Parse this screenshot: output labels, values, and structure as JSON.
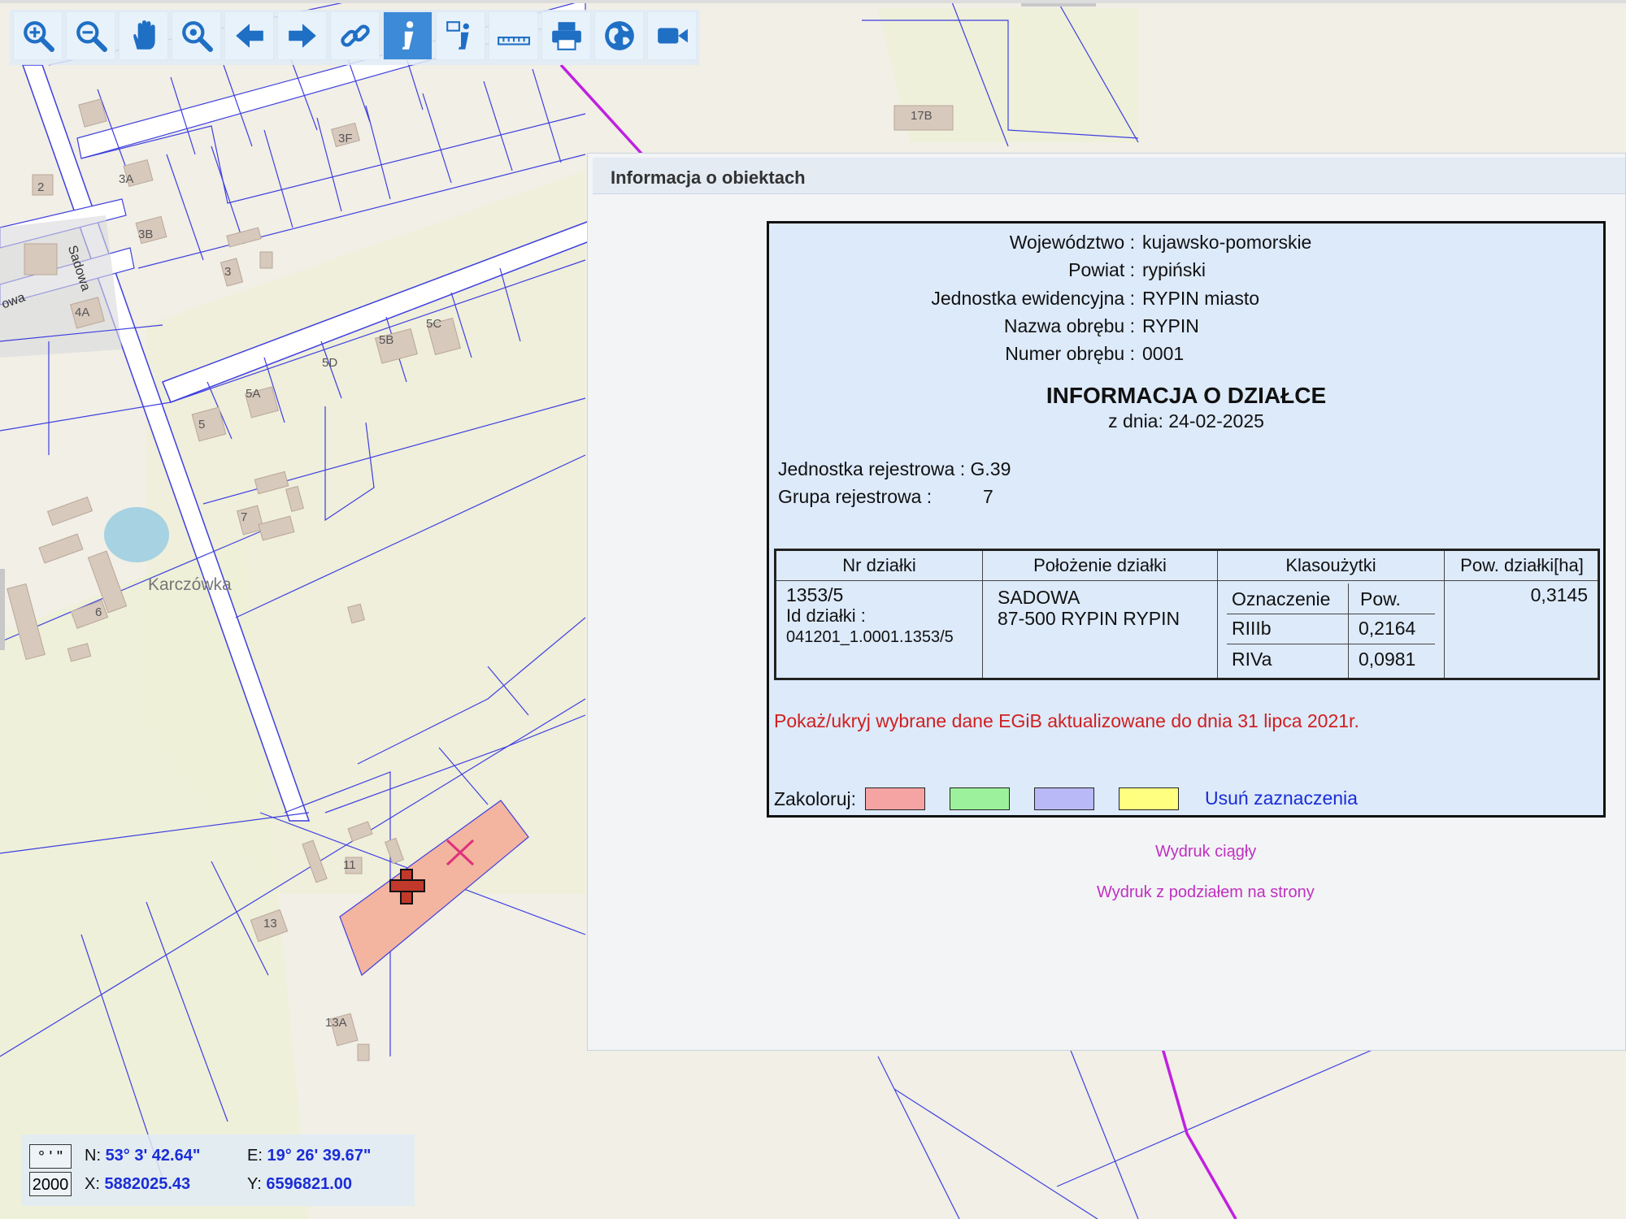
{
  "map": {
    "street_label": "Sadowa",
    "street_label_cut": "owa",
    "locality": "Karczówka",
    "house_numbers": [
      "2",
      "3A",
      "3B",
      "3F",
      "3",
      "4A",
      "5",
      "5A",
      "5B",
      "5C",
      "5D",
      "6",
      "7",
      "11",
      "13",
      "13A",
      "17B"
    ]
  },
  "toolbar": {
    "tools": [
      "zoom-in-icon",
      "zoom-out-icon",
      "pan-hand-icon",
      "zoom-extent-icon",
      "back-arrow-icon",
      "forward-arrow-icon",
      "link-icon",
      "info-icon",
      "info-advanced-icon",
      "ruler-icon",
      "print-icon",
      "globe-icon",
      "video-icon"
    ],
    "active_tool": "info-icon"
  },
  "dialog": {
    "title": "Informacja o obiektach",
    "admin": [
      {
        "label": "Województwo :",
        "value": "kujawsko-pomorskie"
      },
      {
        "label": "Powiat :",
        "value": "rypiński"
      },
      {
        "label": "Jednostka ewidencyjna :",
        "value": "RYPIN miasto"
      },
      {
        "label": "Nazwa obrębu :",
        "value": "RYPIN"
      },
      {
        "label": "Numer obrębu :",
        "value": "0001"
      }
    ],
    "heading": "INFORMACJA O DZIAŁCE",
    "date_line": "z dnia: 24-02-2025",
    "unit_label": "Jednostka rejestrowa :",
    "unit_value": "G.39",
    "group_label": "Grupa rejestrowa :",
    "group_value": "7",
    "table": {
      "headers": [
        "Nr działki",
        "Położenie działki",
        "Klasoużytki",
        "Pow. działki[ha]"
      ],
      "parcel_no": "1353/5",
      "id_label": "Id działki :",
      "id_value": "041201_1.0001.1353/5",
      "location_street": "SADOWA",
      "location_city": "87-500 RYPIN RYPIN",
      "class_headers": [
        "Oznaczenie",
        "Pow."
      ],
      "classes": [
        {
          "code": "RIIIb",
          "area": "0,2164"
        },
        {
          "code": "RIVa",
          "area": "0,0981"
        }
      ],
      "area": "0,3145"
    },
    "toggle_link": "Pokaż/ukryj wybrane dane EGiB aktualizowane do dnia 31 lipca 2021r.",
    "color_label": "Zakoloruj:",
    "color_swatches": [
      "#f6a3a3",
      "#9cf29c",
      "#b9b9f7",
      "#ffff80"
    ],
    "clear_link": "Usuń zaznaczenia",
    "print_continuous": "Wydruk ciągły",
    "print_pages": "Wydruk z podziałem na strony"
  },
  "coords": {
    "format_dms": "° ' \"",
    "epsg": "2000",
    "n_label": "N:",
    "n_value": "53° 3' 42.64\"",
    "e_label": "E:",
    "e_value": "19° 26' 39.67\"",
    "x_label": "X:",
    "x_value": "5882025.43",
    "y_label": "Y:",
    "y_value": "6596821.00"
  },
  "colors": {
    "parcel_line": "#3f3fe0",
    "boundary": "#c020e0",
    "selected_parcel": "#f3b4a0",
    "link_blue": "#1a2dd6",
    "link_red": "#d02020",
    "print_link": "#c030c0"
  }
}
